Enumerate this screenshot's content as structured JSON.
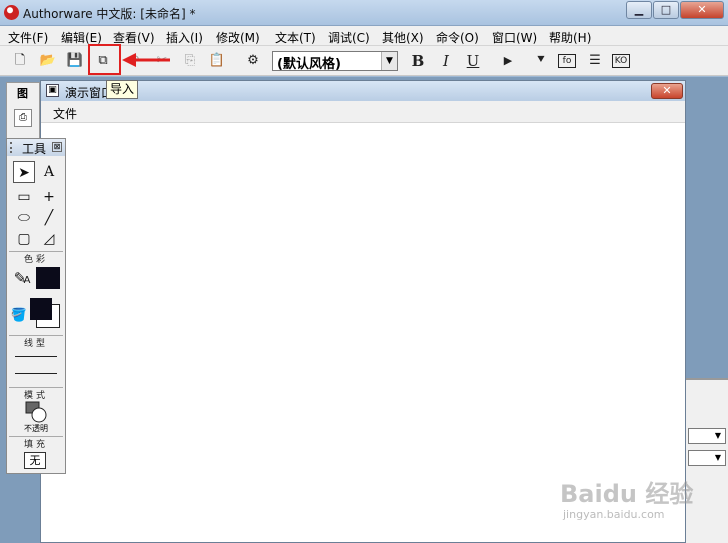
{
  "window": {
    "title": "Authorware 中文版: [未命名] *",
    "minimize_glyph": "▁",
    "maximize_glyph": "□",
    "close_glyph": "✕"
  },
  "menubar": {
    "items": [
      "文件(F)",
      "编辑(E)",
      "查看(V)",
      "插入(I)",
      "修改(M)",
      "文本(T)",
      "调试(C)",
      "其他(X)",
      "命令(O)",
      "窗口(W)",
      "帮助(H)"
    ]
  },
  "toolbar": {
    "buttons": [
      {
        "name": "new-file-icon",
        "glyph": "🗋"
      },
      {
        "name": "open-folder-icon",
        "glyph": "📂"
      },
      {
        "name": "save-all-icon",
        "glyph": "💾"
      },
      {
        "name": "import-icon",
        "glyph": "⧉"
      },
      {
        "name": "undo-icon",
        "glyph": "↶"
      },
      {
        "name": "cut-icon",
        "glyph": "✂"
      },
      {
        "name": "copy-icon",
        "glyph": "⎘"
      },
      {
        "name": "paste-icon",
        "glyph": "📋"
      },
      {
        "name": "find-icon",
        "glyph": "⚙"
      }
    ],
    "style_select": {
      "value": "(默认风格)",
      "arrow": "▼"
    },
    "bold_label": "B",
    "italic_label": "I",
    "underline_label": "U",
    "run_glyph": "▶",
    "control_panel_glyph": "⯆",
    "function_label": "fo",
    "variables_glyph": "☰",
    "knowledge_label": "KO",
    "accent_color": "#e02020"
  },
  "tooltip": {
    "text": "导入"
  },
  "icon_palette": {
    "title": "图",
    "button_glyph": "⎙"
  },
  "presentation": {
    "title": "演示窗口",
    "close_glyph": "✕",
    "menu": {
      "file": "文件"
    },
    "icon_glyph": "▣"
  },
  "tools": {
    "title": "工具",
    "close_glyph": "⊠",
    "pointer_glyph": "➤",
    "text_glyph": "A",
    "rect_glyph": "▭",
    "cross_glyph": "+",
    "ellipse_glyph": "⬭",
    "line_glyph": "╱",
    "rounded_rect_glyph": "▢",
    "polygon_glyph": "◿",
    "color_label": "色彩",
    "pencil_glyph": "✎",
    "text_color_glyph": "A",
    "bucket_glyph": "🪣",
    "line_type_label": "线型",
    "mode_label": "模式",
    "mode_value": "不透明",
    "fill_label": "填充",
    "fill_value": "无",
    "color_swatch": "#0b0b1a"
  },
  "right_panel": {
    "dropdown_glyph": "▼"
  },
  "watermark": {
    "logo": "Baidu 经验",
    "url": "jingyan.baidu.com"
  }
}
